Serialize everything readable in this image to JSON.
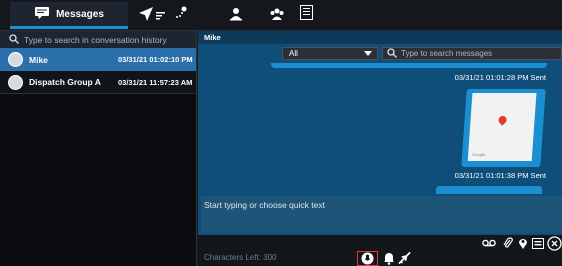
{
  "topbar": {
    "messages_tab_label": "Messages",
    "icons": [
      "chat-bubble-icon",
      "location-arrow-icon",
      "sort-icon",
      "route-icon",
      "person-badge-icon",
      "group-icon",
      "list-icon"
    ]
  },
  "left_panel": {
    "search_placeholder": "Type to search in conversation history",
    "conversations": [
      {
        "name": "Mike",
        "time": "03/31/21 01:02:10 PM",
        "active": true
      },
      {
        "name": "Dispatch Group A",
        "time": "03/31/21 11:57:23 AM",
        "active": false
      }
    ]
  },
  "chat": {
    "header_title": "Mike",
    "filter_selected": "All",
    "search_placeholder": "Type to search messages",
    "messages": [
      {
        "meta": "03/31/21 01:01:28 PM Sent",
        "kind": "location-map"
      },
      {
        "meta": "03/31/21 01:01:38 PM Sent",
        "kind": "image"
      }
    ],
    "map_watermark": "Google",
    "compose_placeholder": "Start typing or choose quick text",
    "characters_left": "Characters Left: 300"
  },
  "colors": {
    "accent": "#1b8fd1",
    "active_row": "#2a6fa9",
    "chat_bg": "#0e4e78",
    "danger": "#e53935"
  }
}
